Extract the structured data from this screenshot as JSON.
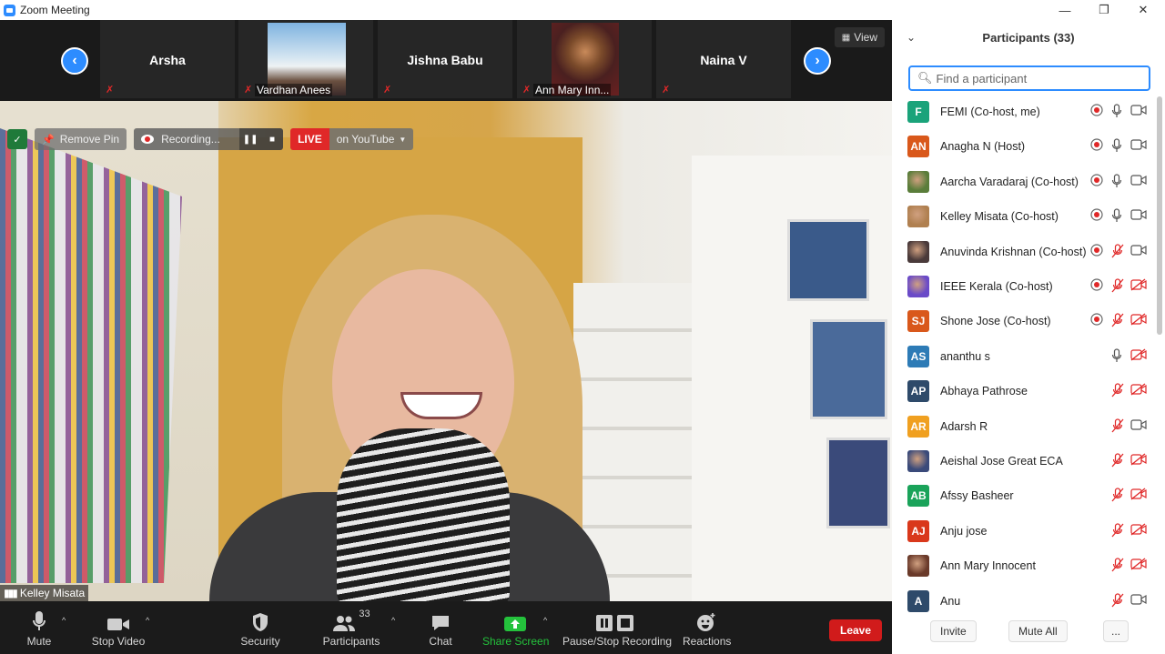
{
  "window": {
    "title": "Zoom Meeting",
    "minimize": "—",
    "restore": "❐",
    "close": "✕"
  },
  "strip": {
    "prev": "‹",
    "next": "›",
    "view_label": "View",
    "thumbs": [
      {
        "name": "Arsha",
        "label": ""
      },
      {
        "name": "",
        "label": "Vardhan Anees"
      },
      {
        "name": "Jishna Babu",
        "label": ""
      },
      {
        "name": "",
        "label": "Ann Mary Inn..."
      },
      {
        "name": "Naina V",
        "label": ""
      }
    ]
  },
  "overlay": {
    "remove_pin": "Remove Pin",
    "recording": "Recording...",
    "live": "LIVE",
    "on_youtube": "on YouTube"
  },
  "video": {
    "speaker": "Kelley Misata"
  },
  "toolbar": {
    "mute": "Mute",
    "stop_video": "Stop Video",
    "security": "Security",
    "participants": "Participants",
    "participants_count": "33",
    "chat": "Chat",
    "share_screen": "Share Screen",
    "pause_recording": "Pause/Stop Recording",
    "reactions": "Reactions",
    "leave": "Leave"
  },
  "panel": {
    "title": "Participants (33)",
    "search_placeholder": "Find a participant",
    "participants": [
      {
        "initials": "F",
        "name": "FEMI (Co-host, me)",
        "color": "#1aa37a",
        "rec": true,
        "mic_on": true,
        "cam_on": true
      },
      {
        "initials": "AN",
        "name": "Anagha N  (Host)",
        "color": "#d9581b",
        "rec": true,
        "mic_on": true,
        "cam_on": true
      },
      {
        "initials": "",
        "name": "Aarcha Varadaraj (Co-host)",
        "color": "#5a7d3a",
        "rec": true,
        "mic_on": true,
        "cam_on": true
      },
      {
        "initials": "",
        "name": "Kelley Misata (Co-host)",
        "color": "#b08050",
        "rec": true,
        "mic_on": true,
        "cam_on": true
      },
      {
        "initials": "",
        "name": "Anuvinda Krishnan (Co-host)",
        "color": "#4a3a3a",
        "rec": true,
        "mic_on": false,
        "cam_on": true
      },
      {
        "initials": "",
        "name": "IEEE Kerala (Co-host)",
        "color": "#6a4ac8",
        "rec": true,
        "mic_on": false,
        "cam_on": false
      },
      {
        "initials": "SJ",
        "name": "Shone Jose (Co-host)",
        "color": "#d9581b",
        "rec": true,
        "mic_on": false,
        "cam_on": false
      },
      {
        "initials": "AS",
        "name": "ananthu s",
        "color": "#2d7bb6",
        "rec": false,
        "mic_on": true,
        "cam_on": false
      },
      {
        "initials": "AP",
        "name": "Abhaya Pathrose",
        "color": "#2e4a6a",
        "rec": false,
        "mic_on": false,
        "cam_on": false
      },
      {
        "initials": "AR",
        "name": "Adarsh R",
        "color": "#f0a020",
        "rec": false,
        "mic_on": false,
        "cam_on": true
      },
      {
        "initials": "",
        "name": "Aeishal Jose Great ECA",
        "color": "#3a4a7a",
        "rec": false,
        "mic_on": false,
        "cam_on": false
      },
      {
        "initials": "AB",
        "name": "Afssy Basheer",
        "color": "#1aa35a",
        "rec": false,
        "mic_on": false,
        "cam_on": false
      },
      {
        "initials": "AJ",
        "name": "Anju jose",
        "color": "#d9381b",
        "rec": false,
        "mic_on": false,
        "cam_on": false
      },
      {
        "initials": "",
        "name": "Ann Mary Innocent",
        "color": "#6a3a2a",
        "rec": false,
        "mic_on": false,
        "cam_on": false
      },
      {
        "initials": "A",
        "name": "Anu",
        "color": "#2e4a6a",
        "rec": false,
        "mic_on": false,
        "cam_on": true
      }
    ],
    "invite": "Invite",
    "mute_all": "Mute All",
    "more": "..."
  }
}
